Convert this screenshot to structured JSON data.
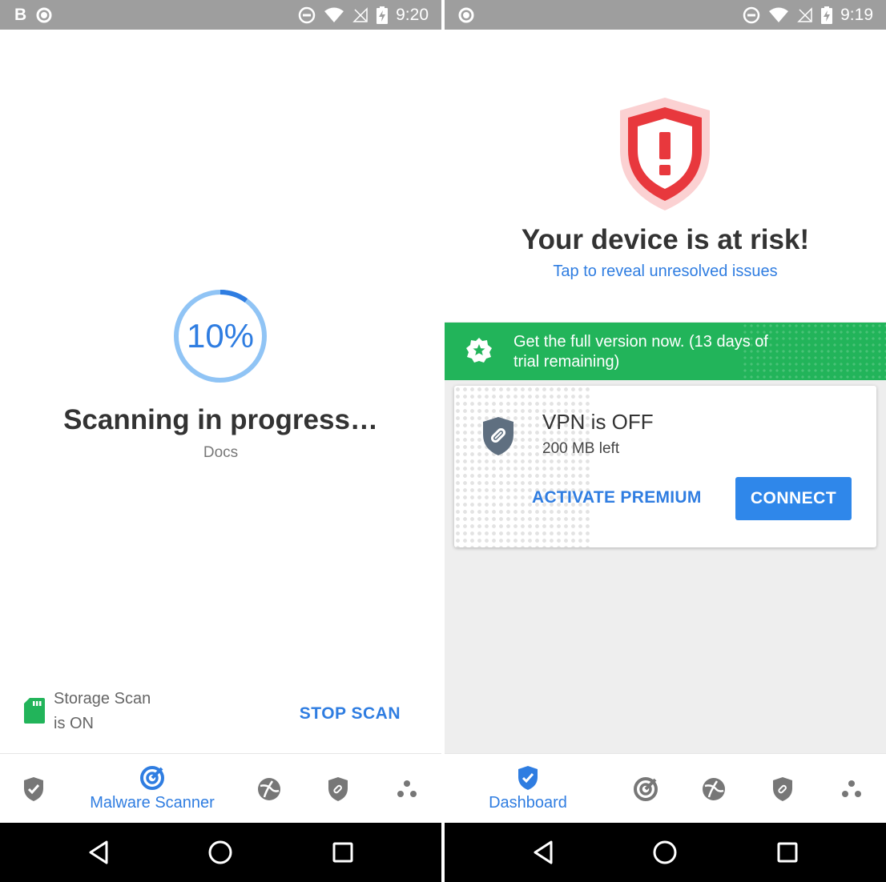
{
  "left_screen": {
    "status_bar": {
      "time": "9:20",
      "app_badge": "B"
    },
    "scan": {
      "progress_percent": 10,
      "progress_label": "10%",
      "title": "Scanning in progress…",
      "current_item": "Docs"
    },
    "storage": {
      "line1": "Storage Scan",
      "line2": "is ON",
      "stop_label": "STOP SCAN"
    },
    "tabs": {
      "active_label": "Malware Scanner"
    }
  },
  "right_screen": {
    "status_bar": {
      "time": "9:19"
    },
    "risk": {
      "title": "Your device is at risk!",
      "link": "Tap to reveal unresolved issues"
    },
    "promo": {
      "line1": "Get the full version now. (13 days of",
      "line2": "trial remaining)"
    },
    "vpn": {
      "title": "VPN is OFF",
      "data_left": "200 MB left",
      "activate_label": "ACTIVATE PREMIUM",
      "connect_label": "CONNECT"
    },
    "tabs": {
      "active_label": "Dashboard"
    }
  },
  "icons": {
    "tabs": [
      "shield-check-icon",
      "radar-scan-icon",
      "globe-icon",
      "vpn-shield-icon",
      "more-dots-icon"
    ],
    "nav": [
      "back-icon",
      "home-icon",
      "recents-icon"
    ]
  },
  "colors": {
    "accent": "#2f7de1",
    "promo_green": "#22b45a",
    "risk_red": "#e8383d",
    "tab_gray": "#777777"
  }
}
